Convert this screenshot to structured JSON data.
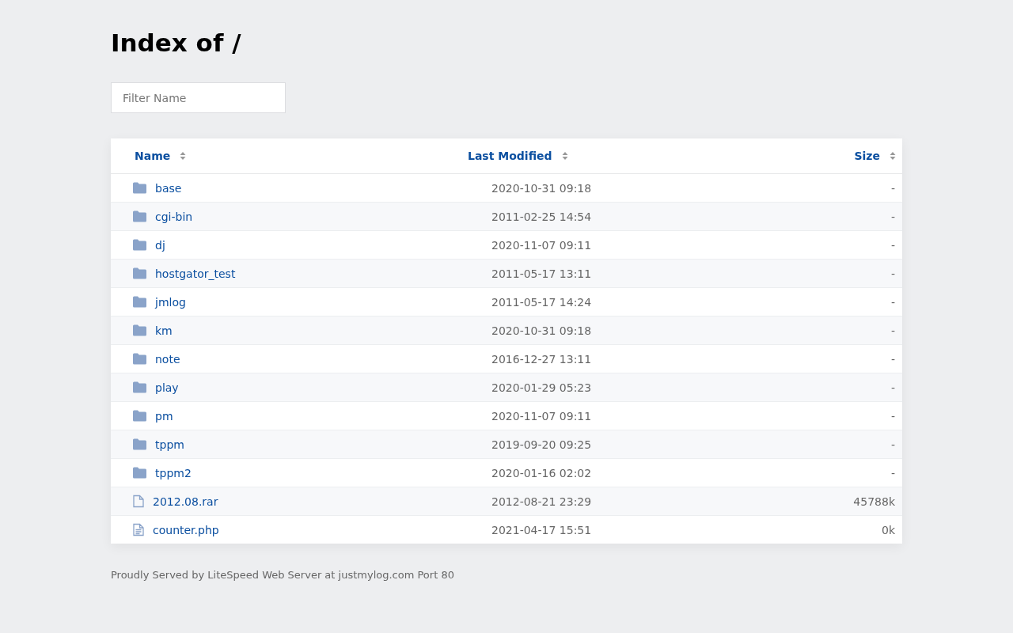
{
  "title": "Index of /",
  "filter": {
    "placeholder": "Filter Name"
  },
  "columns": [
    "Name",
    "Last Modified",
    "Size"
  ],
  "rows": [
    {
      "kind": "folder",
      "name": "base",
      "modified": "2020-10-31 09:18",
      "size": "-"
    },
    {
      "kind": "folder",
      "name": "cgi-bin",
      "modified": "2011-02-25 14:54",
      "size": "-"
    },
    {
      "kind": "folder",
      "name": "dj",
      "modified": "2020-11-07 09:11",
      "size": "-"
    },
    {
      "kind": "folder",
      "name": "hostgator_test",
      "modified": "2011-05-17 13:11",
      "size": "-"
    },
    {
      "kind": "folder",
      "name": "jmlog",
      "modified": "2011-05-17 14:24",
      "size": "-"
    },
    {
      "kind": "folder",
      "name": "km",
      "modified": "2020-10-31 09:18",
      "size": "-"
    },
    {
      "kind": "folder",
      "name": "note",
      "modified": "2016-12-27 13:11",
      "size": "-"
    },
    {
      "kind": "folder",
      "name": "play",
      "modified": "2020-01-29 05:23",
      "size": "-"
    },
    {
      "kind": "folder",
      "name": "pm",
      "modified": "2020-11-07 09:11",
      "size": "-"
    },
    {
      "kind": "folder",
      "name": "tppm",
      "modified": "2019-09-20 09:25",
      "size": "-"
    },
    {
      "kind": "folder",
      "name": "tppm2",
      "modified": "2020-01-16 02:02",
      "size": "-"
    },
    {
      "kind": "file",
      "name": "2012.08.rar",
      "modified": "2012-08-21 23:29",
      "size": "45788k"
    },
    {
      "kind": "text-file",
      "name": "counter.php",
      "modified": "2021-04-17 15:51",
      "size": "0k"
    }
  ],
  "footer": "Proudly Served by LiteSpeed Web Server at justmylog.com Port 80"
}
